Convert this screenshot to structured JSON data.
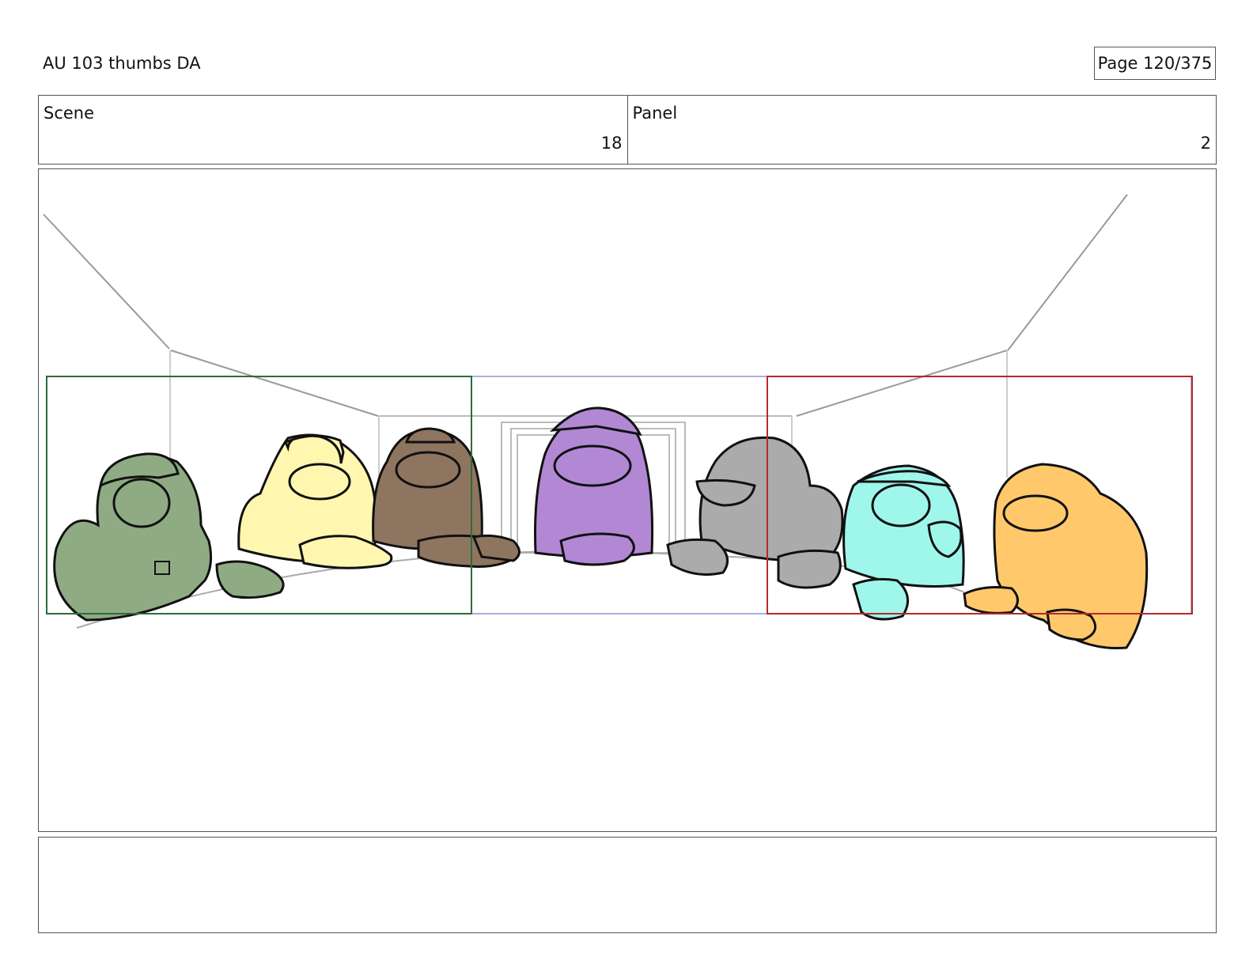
{
  "header": {
    "title": "AU 103 thumbs DA",
    "page_label": "Page 120/375"
  },
  "info": {
    "scene_label": "Scene",
    "scene_value": "18",
    "panel_label": "Panel",
    "panel_value": "2"
  },
  "colors": {
    "green_character": "#8fab84",
    "yellow_character": "#fff7b0",
    "brown_character": "#8e7560",
    "purple_character": "#b288d4",
    "gray_character": "#ababab",
    "cyan_character": "#9ff7ec",
    "orange_character": "#ffc96b",
    "left_frame": "#2f6a3a",
    "center_frame": "#aab0dd",
    "right_frame": "#b52a2a"
  },
  "notes": {
    "text": ""
  }
}
